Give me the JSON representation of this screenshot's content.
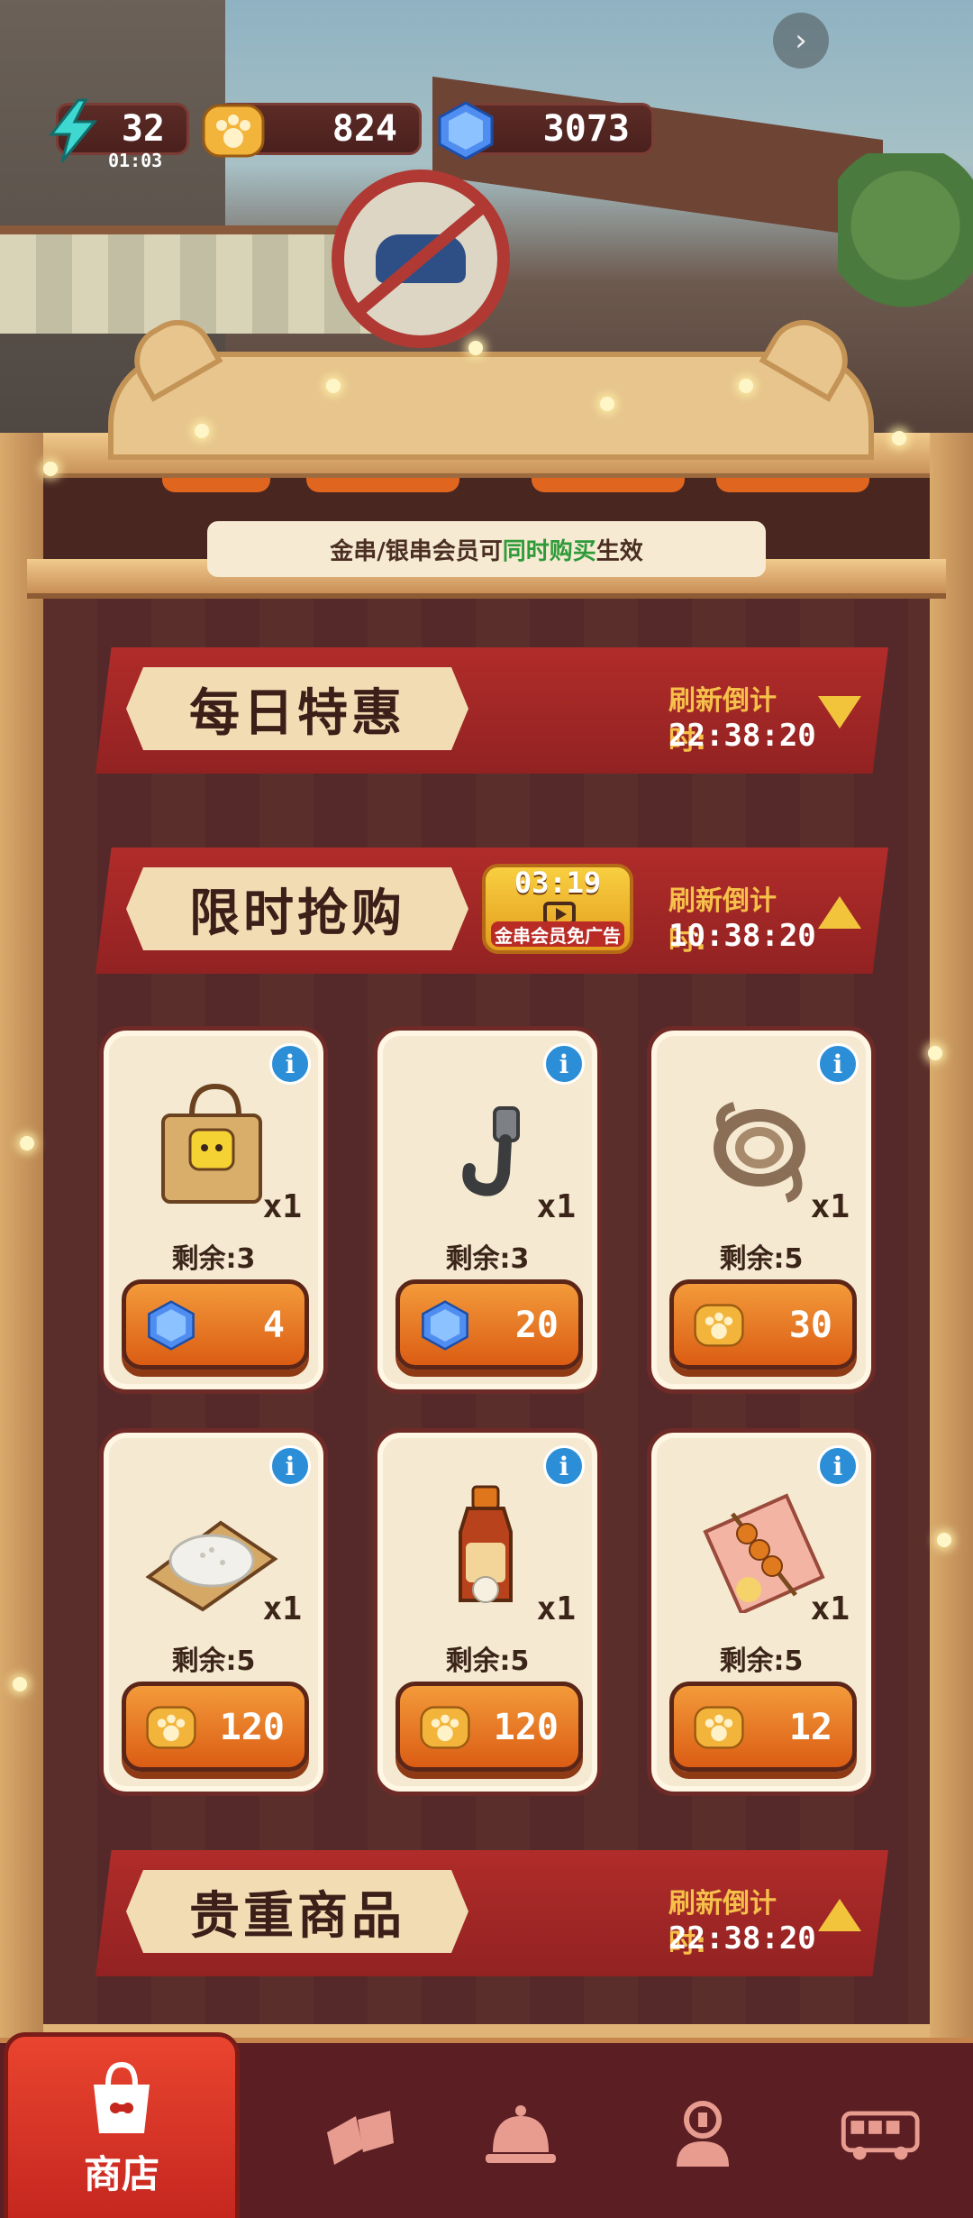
{
  "status": {
    "energy": "32",
    "energy_timer": "01:03",
    "coins": "824",
    "gems": "3073"
  },
  "notice": {
    "prefix": "金串/银串会员可",
    "highlight": "同时购买",
    "suffix": "生效"
  },
  "sections": {
    "daily": {
      "title": "每日特惠",
      "refresh_label": "刷新倒计时:",
      "countdown": "22:38:20",
      "arrow": "chevron-down"
    },
    "flash": {
      "title": "限时抢购",
      "refresh_label": "刷新倒计时:",
      "countdown": "10:38:20",
      "arrow": "chevron-up"
    },
    "premium": {
      "title": "贵重商品",
      "refresh_label": "刷新倒计时:",
      "countdown": "22:38:20",
      "arrow": "chevron-up"
    }
  },
  "ad_button": {
    "countdown": "03:19",
    "label": "金串会员免广告"
  },
  "items": [
    {
      "icon": "paper-bag-icon",
      "qty": "x1",
      "remaining": "剩余:3",
      "currency": "gem",
      "price": "4"
    },
    {
      "icon": "hook-icon",
      "qty": "x1",
      "remaining": "剩余:3",
      "currency": "gem",
      "price": "20"
    },
    {
      "icon": "rope-icon",
      "qty": "x1",
      "remaining": "剩余:5",
      "currency": "paw-coin",
      "price": "30"
    },
    {
      "icon": "rice-icon",
      "qty": "x1",
      "remaining": "剩余:5",
      "currency": "paw-coin",
      "price": "120"
    },
    {
      "icon": "sauce-bottle-icon",
      "qty": "x1",
      "remaining": "剩余:5",
      "currency": "paw-coin",
      "price": "120"
    },
    {
      "icon": "meatball-skewer-icon",
      "qty": "x1",
      "remaining": "剩余:5",
      "currency": "paw-coin",
      "price": "12"
    }
  ],
  "nav": {
    "shop_label": "商店",
    "icons": [
      "shop-bag-icon",
      "ticket-icon",
      "service-bell-icon",
      "chef-badge-icon",
      "bus-icon"
    ]
  },
  "colors": {
    "banner_red": "#a82828",
    "price_orange": "#e8701e",
    "card_bg": "#f5e9d2",
    "gem_blue": "#3f7fe8",
    "coin_gold": "#f2b43a",
    "highlight_green": "#2f9a3a"
  }
}
